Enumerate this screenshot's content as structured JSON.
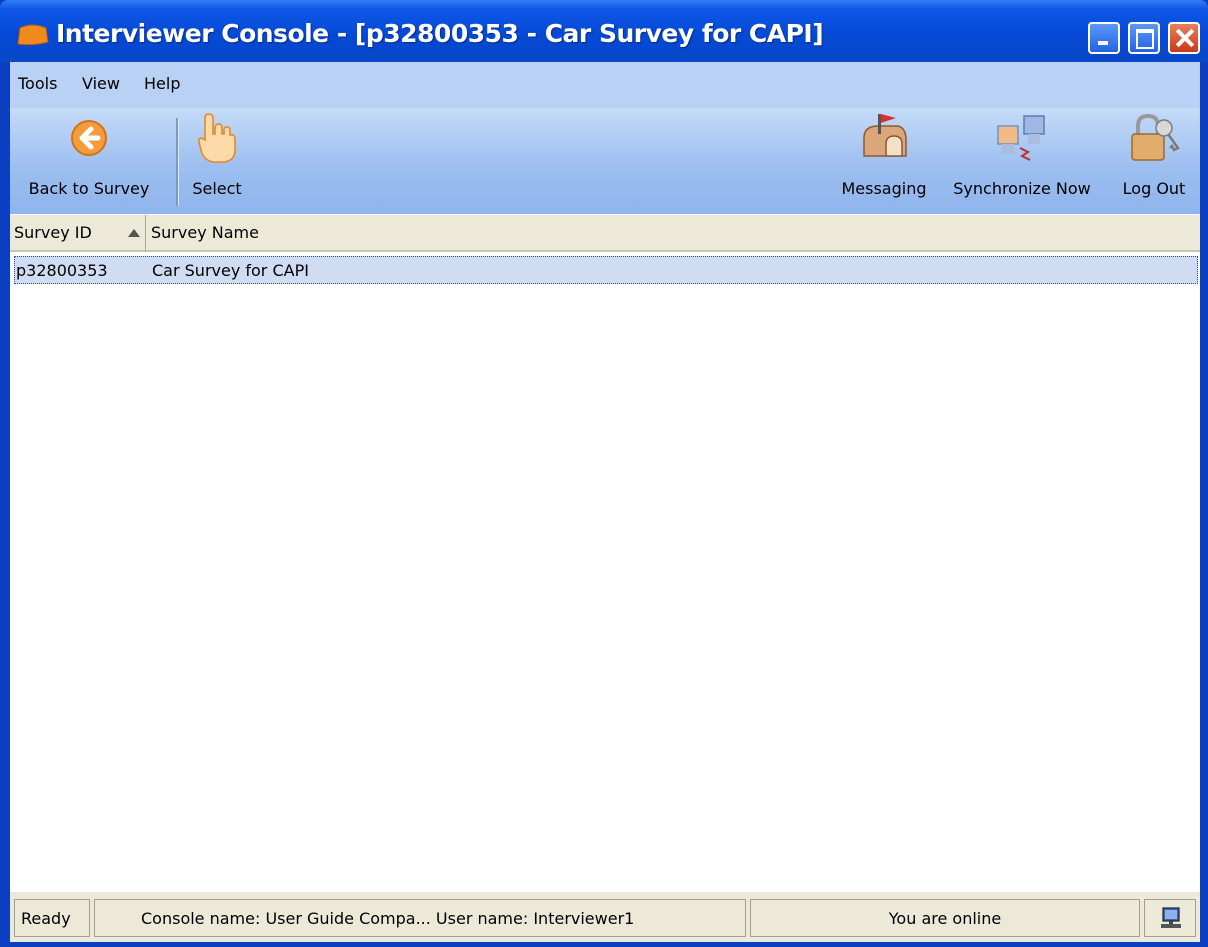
{
  "window": {
    "title": "Interviewer Console - [p32800353 - Car Survey for CAPI]"
  },
  "menu": {
    "items": [
      "Tools",
      "View",
      "Help"
    ]
  },
  "toolbar": {
    "back_label": "Back to Survey",
    "select_label": "Select",
    "messaging_label": "Messaging",
    "sync_label": "Synchronize Now",
    "logout_label": "Log Out"
  },
  "grid": {
    "columns": [
      "Survey ID",
      "Survey Name"
    ],
    "rows": [
      {
        "id": "p32800353",
        "name": "Car Survey for CAPI"
      }
    ]
  },
  "status": {
    "ready": "Ready",
    "info": "Console name:  User Guide Compa...  User name: Interviewer1",
    "online": "You are online"
  },
  "colors": {
    "titlebar": "#0448d4",
    "menubar": "#b9d1f4",
    "selection": "#cfdcf2",
    "close_button": "#c6391a"
  }
}
